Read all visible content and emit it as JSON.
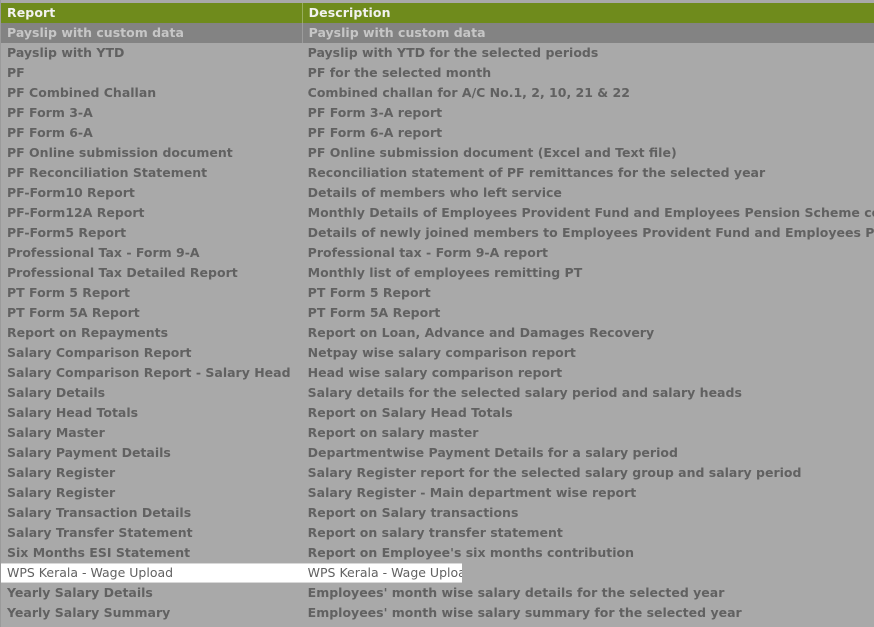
{
  "grid": {
    "columns": [
      {
        "key": "report",
        "label": "Report"
      },
      {
        "key": "description",
        "label": "Description"
      }
    ],
    "accent_header_color": "#6f8b1c",
    "background_color": "#a9a9a9",
    "selected_row_color": "#838383",
    "text_color": "#616161",
    "editing_row_color": "#ffffff",
    "rows": [
      {
        "report": "Payslip with custom data",
        "description": "Payslip with custom data",
        "state": "selected"
      },
      {
        "report": "Payslip with YTD",
        "description": "Payslip with YTD for the selected periods",
        "state": "normal"
      },
      {
        "report": "PF",
        "description": "PF for the selected month",
        "state": "normal"
      },
      {
        "report": "PF Combined Challan",
        "description": "Combined challan for A/C No.1, 2, 10, 21 & 22",
        "state": "normal"
      },
      {
        "report": "PF Form 3-A",
        "description": "PF Form 3-A report",
        "state": "normal"
      },
      {
        "report": "PF Form 6-A",
        "description": "PF Form 6-A report",
        "state": "normal"
      },
      {
        "report": "PF Online submission document",
        "description": "PF Online submission document (Excel and Text file)",
        "state": "normal"
      },
      {
        "report": "PF Reconciliation Statement",
        "description": "Reconciliation statement of PF remittances for the selected year",
        "state": "normal"
      },
      {
        "report": "PF-Form10 Report",
        "description": "Details of members who left service",
        "state": "normal"
      },
      {
        "report": "PF-Form12A Report",
        "description": "Monthly Details of Employees Provident Fund and Employees Pension Scheme contributions",
        "state": "normal"
      },
      {
        "report": "PF-Form5 Report",
        "description": "Details of newly joined members to Employees Provident Fund and Employees Pension Scheme",
        "state": "normal"
      },
      {
        "report": "Professional Tax - Form 9-A",
        "description": "Professional tax - Form 9-A report",
        "state": "normal"
      },
      {
        "report": "Professional Tax Detailed Report",
        "description": "Monthly list of employees remitting PT",
        "state": "normal"
      },
      {
        "report": "PT Form 5 Report",
        "description": "PT Form 5 Report",
        "state": "normal"
      },
      {
        "report": "PT Form 5A Report",
        "description": "PT Form 5A Report",
        "state": "normal"
      },
      {
        "report": "Report on Repayments",
        "description": "Report on Loan, Advance and Damages Recovery",
        "state": "normal"
      },
      {
        "report": "Salary Comparison Report",
        "description": "Netpay wise salary comparison report",
        "state": "normal"
      },
      {
        "report": "Salary Comparison Report - Salary Head",
        "description": "Head wise salary comparison report",
        "state": "normal"
      },
      {
        "report": "Salary Details",
        "description": "Salary details for the selected salary period and salary heads",
        "state": "normal"
      },
      {
        "report": "Salary Head Totals",
        "description": "Report on Salary Head Totals",
        "state": "normal"
      },
      {
        "report": "Salary Master",
        "description": "Report on salary master",
        "state": "normal"
      },
      {
        "report": "Salary Payment Details",
        "description": "Departmentwise Payment Details for a salary period",
        "state": "normal"
      },
      {
        "report": "Salary Register",
        "description": "Salary Register report for the selected salary group and salary period",
        "state": "normal"
      },
      {
        "report": "Salary Register",
        "description": "Salary Register - Main department wise report",
        "state": "normal"
      },
      {
        "report": "Salary Transaction Details",
        "description": "Report on Salary transactions",
        "state": "normal"
      },
      {
        "report": "Salary Transfer Statement",
        "description": "Report on salary transfer statement",
        "state": "normal"
      },
      {
        "report": "Six Months ESI Statement",
        "description": "Report on Employee's six months contribution",
        "state": "normal"
      },
      {
        "report": "WPS Kerala - Wage Upload",
        "description": "WPS Kerala - Wage Upload",
        "state": "editing"
      },
      {
        "report": "Yearly Salary Details",
        "description": "Employees' month wise salary details for the selected year",
        "state": "normal"
      },
      {
        "report": "Yearly Salary Summary",
        "description": "Employees' month wise salary summary for the selected year",
        "state": "normal"
      }
    ]
  }
}
